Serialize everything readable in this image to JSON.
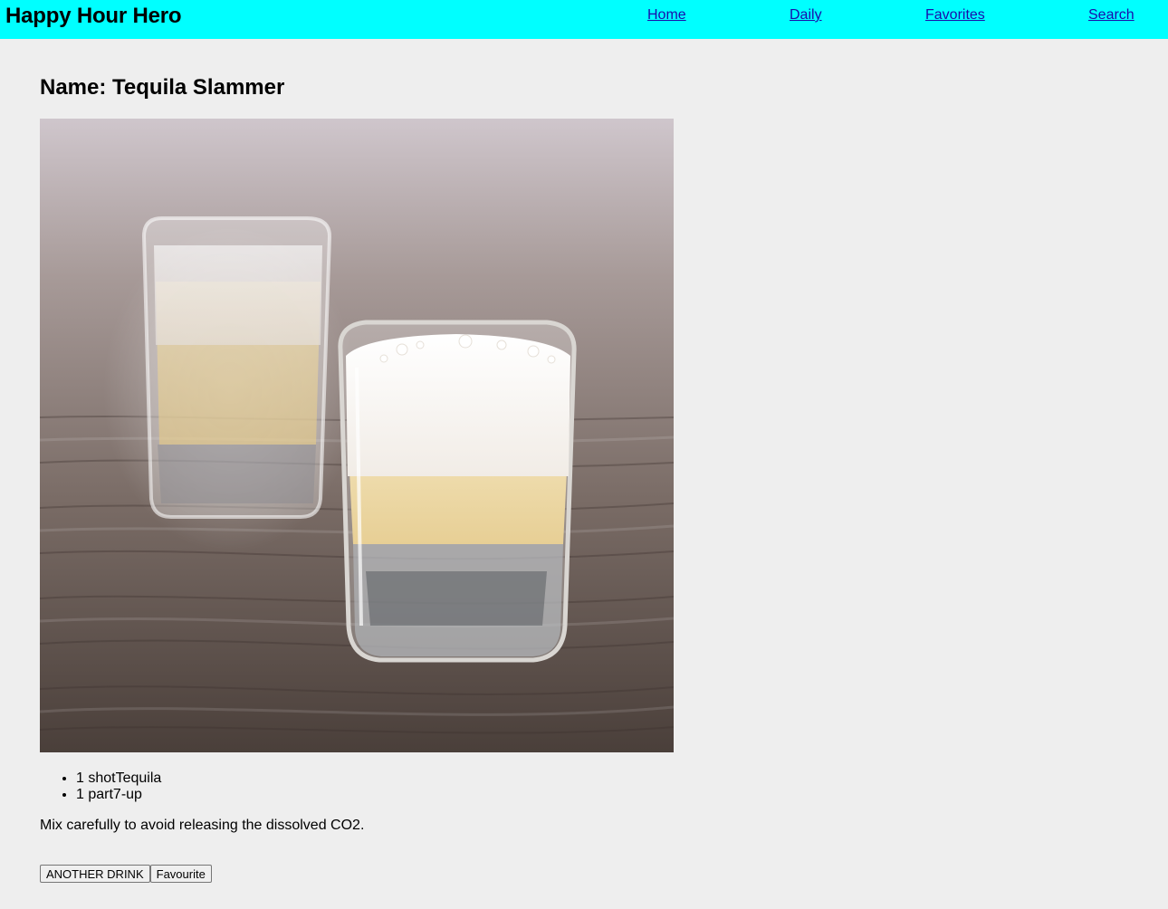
{
  "app": {
    "title": "Happy Hour Hero"
  },
  "nav": {
    "home": "Home",
    "daily": "Daily",
    "favorites": "Favorites",
    "search": "Search"
  },
  "drink": {
    "name_label": "Name: Tequila Slammer",
    "ingredients": [
      "1 shotTequila",
      "1 part7-up"
    ],
    "instructions": "Mix carefully to avoid releasing the dissolved CO2."
  },
  "actions": {
    "another": "ANOTHER DRINK",
    "favourite": "Favourite"
  },
  "colors": {
    "navbar_bg": "#00ffff",
    "page_bg": "#eeeeee",
    "link": "#1a0dab"
  }
}
